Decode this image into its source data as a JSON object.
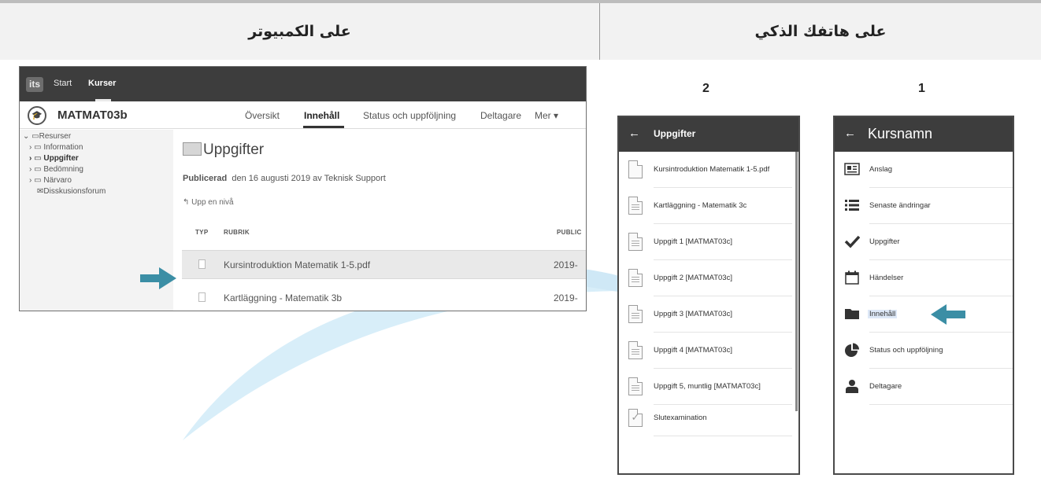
{
  "headers": {
    "computer": "على الكمبيوتر",
    "phone": "على هاتفك الذكي"
  },
  "desktop": {
    "logo": "its",
    "nav": {
      "start": "Start",
      "kurser": "Kurser"
    },
    "course_title": "MATMAT03b",
    "tabs": [
      "Översikt",
      "Innehåll",
      "Status och uppföljning",
      "Deltagare",
      "Mer ▾"
    ],
    "tree": {
      "root": "Resurser",
      "items": [
        "Information",
        "Uppgifter",
        "Bedömning",
        "Närvaro"
      ],
      "forum": "Disskusionsforum"
    },
    "folder_title": "Uppgifter",
    "published_label": "Publicerad",
    "published_text": "den 16 augusti 2019 av Teknisk Support",
    "up_link": "Upp en nivå",
    "columns": {
      "type": "TYP",
      "title": "RUBRIK",
      "published": "PUBLIC"
    },
    "rows": [
      {
        "title": "Kursintroduktion Matematik 1-5.pdf",
        "date": "2019-"
      },
      {
        "title": "Kartläggning - Matematik 3b",
        "date": "2019-"
      }
    ]
  },
  "phone_steps": {
    "step2": "2",
    "step1": "1"
  },
  "phone2": {
    "back": "←",
    "title": "Uppgifter",
    "files": [
      "Kursintroduktion Matematik 1-5.pdf",
      "Kartläggning - Matematik 3c",
      "Uppgift 1 [MATMAT03c]",
      "Uppgift 2 [MATMAT03c]",
      "Uppgift 3 [MATMAT03c]",
      "Uppgift 4 [MATMAT03c]",
      "Uppgift 5, muntlig [MATMAT03c]",
      "Slutexamination"
    ]
  },
  "phone1": {
    "back": "←",
    "title": "Kursnamn",
    "menu": [
      {
        "label": "Anslag",
        "icon": "newspaper-icon"
      },
      {
        "label": "Senaste ändringar",
        "icon": "list-icon"
      },
      {
        "label": "Uppgifter",
        "icon": "checkmark-icon"
      },
      {
        "label": "Händelser",
        "icon": "calendar-icon"
      },
      {
        "label": "Innehåll",
        "icon": "folder-icon"
      },
      {
        "label": "Status och uppföljning",
        "icon": "pie-chart-icon"
      },
      {
        "label": "Deltagare",
        "icon": "person-icon"
      }
    ]
  },
  "colors": {
    "accent_arrow": "#3b8ea5",
    "bar_dark": "#3d3d3d",
    "swoosh": "#cde9f7"
  }
}
